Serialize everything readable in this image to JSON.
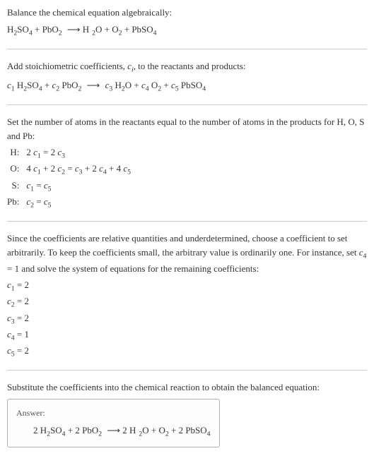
{
  "intro": {
    "line1": "Balance the chemical equation algebraically:",
    "equation_parts": [
      "H",
      "2",
      "SO",
      "4",
      " + PbO",
      "2",
      "  ⟶  H",
      "2",
      "O + O",
      "2",
      " + PbSO",
      "4"
    ]
  },
  "step1": {
    "line1_a": "Add stoichiometric coefficients, ",
    "line1_ci": "c",
    "line1_i": "i",
    "line1_b": ", to the reactants and products:",
    "eq_parts": [
      "c",
      "1",
      " H",
      "2",
      "SO",
      "4",
      " + ",
      "c",
      "2",
      " PbO",
      "2",
      "  ⟶  ",
      "c",
      "3",
      " H",
      "2",
      "O + ",
      "c",
      "4",
      " O",
      "2",
      " + ",
      "c",
      "5",
      " PbSO",
      "4"
    ]
  },
  "step2": {
    "intro": "Set the number of atoms in the reactants equal to the number of atoms in the products for H, O, S and Pb:",
    "rows": [
      {
        "label": "H:",
        "parts": [
          "2 ",
          "c",
          "1",
          " = 2 ",
          "c",
          "3"
        ]
      },
      {
        "label": "O:",
        "parts": [
          "4 ",
          "c",
          "1",
          " + 2 ",
          "c",
          "2",
          " = ",
          "c",
          "3",
          " + 2 ",
          "c",
          "4",
          " + 4 ",
          "c",
          "5"
        ]
      },
      {
        "label": "S:",
        "parts": [
          "c",
          "1",
          " = ",
          "c",
          "5"
        ]
      },
      {
        "label": "Pb:",
        "parts": [
          "c",
          "2",
          " = ",
          "c",
          "5"
        ]
      }
    ]
  },
  "step3": {
    "text_a": "Since the coefficients are relative quantities and underdetermined, choose a coefficient to set arbitrarily. To keep the coefficients small, the arbitrary value is ordinarily one. For instance, set ",
    "c4": "c",
    "c4sub": "4",
    "text_b": " = 1 and solve the system of equations for the remaining coefficients:",
    "coeffs": [
      {
        "c": "c",
        "sub": "1",
        "val": " = 2"
      },
      {
        "c": "c",
        "sub": "2",
        "val": " = 2"
      },
      {
        "c": "c",
        "sub": "3",
        "val": " = 2"
      },
      {
        "c": "c",
        "sub": "4",
        "val": " = 1"
      },
      {
        "c": "c",
        "sub": "5",
        "val": " = 2"
      }
    ]
  },
  "step4": {
    "intro": "Substitute the coefficients into the chemical reaction to obtain the balanced equation:",
    "answer_label": "Answer:",
    "answer_parts": [
      "2 H",
      "2",
      "SO",
      "4",
      " + 2 PbO",
      "2",
      "  ⟶  2 H",
      "2",
      "O + O",
      "2",
      " + 2 PbSO",
      "4"
    ]
  }
}
